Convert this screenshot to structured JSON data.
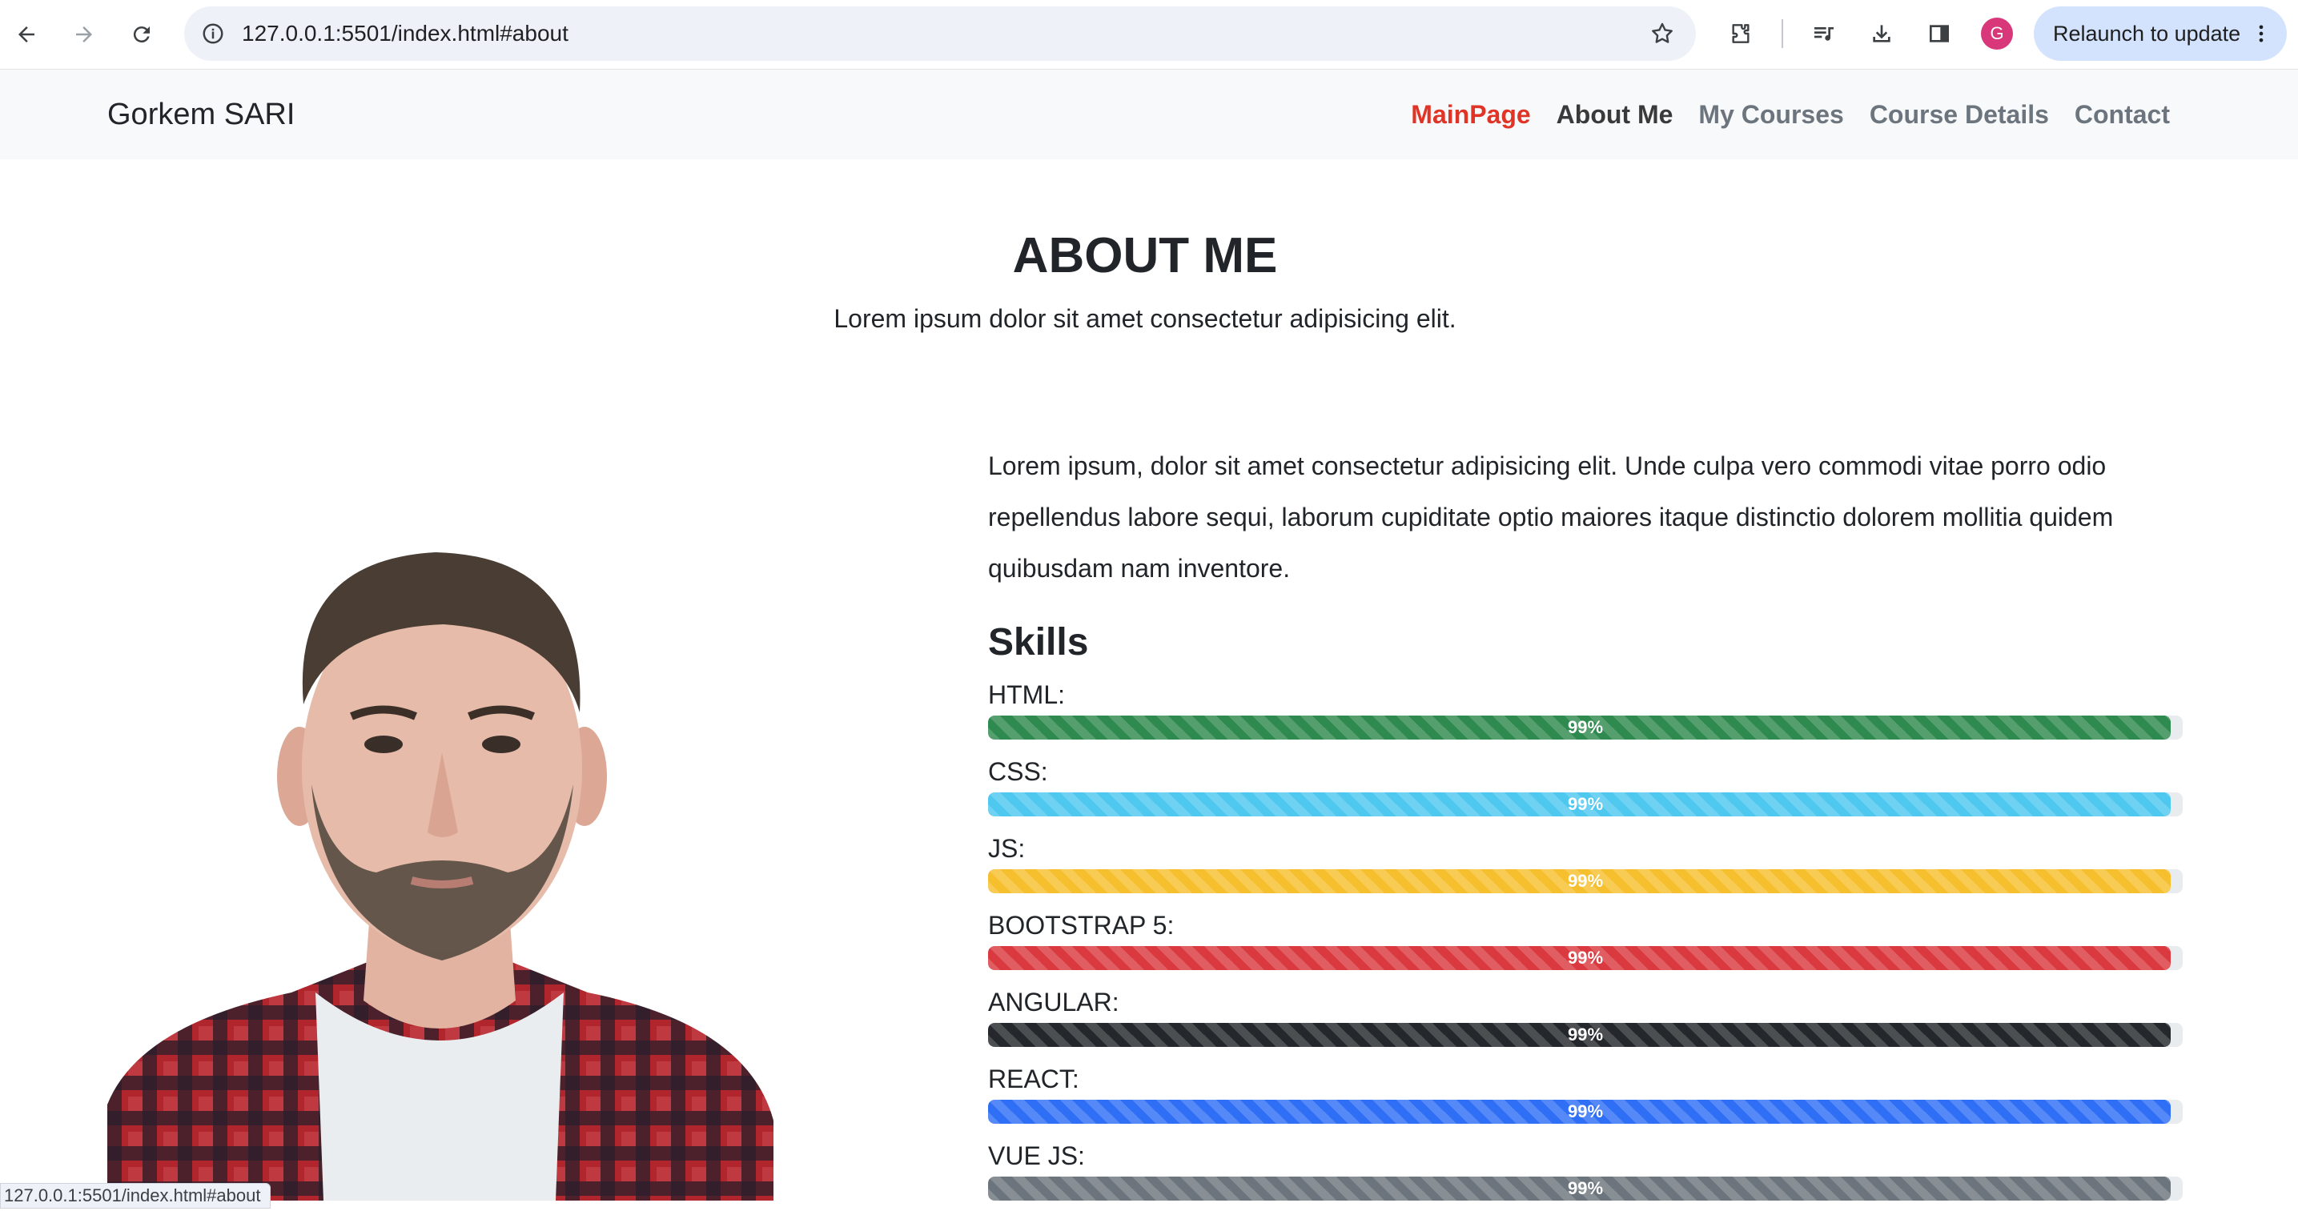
{
  "browser": {
    "url": "127.0.0.1:5501/index.html#about",
    "relaunch_label": "Relaunch to update",
    "profile_initial": "G",
    "status_url": "127.0.0.1:5501/index.html#about",
    "icons": [
      "back-arrow-icon",
      "forward-arrow-icon",
      "reload-icon",
      "site-info-icon",
      "bookmark-star-icon",
      "extensions-puzzle-icon",
      "media-queue-icon",
      "download-icon",
      "side-panel-icon",
      "more-vert-icon"
    ]
  },
  "navbar": {
    "brand": "Gorkem SARI",
    "links": [
      {
        "label": "MainPage"
      },
      {
        "label": "About Me"
      },
      {
        "label": "My Courses"
      },
      {
        "label": "Course Details"
      },
      {
        "label": "Contact"
      }
    ],
    "active_color": "#e03426"
  },
  "about": {
    "title": "ABOUT ME",
    "subtitle": "Lorem ipsum dolor sit amet consectetur adipisicing elit.",
    "paragraph": "Lorem ipsum, dolor sit amet consectetur adipisicing elit. Unde culpa vero commodi vitae porro odio repellendus labore sequi, laborum cupiditate optio maiores itaque distinctio dolorem mollitia quidem quibusdam nam inventore.",
    "skills_title": "Skills",
    "skills": [
      {
        "label": "HTML:",
        "percent_text": "99%",
        "value": 99,
        "color": "#2f8a4f"
      },
      {
        "label": "CSS:",
        "percent_text": "99%",
        "value": 99,
        "color": "#4fc8ef"
      },
      {
        "label": "JS:",
        "percent_text": "99%",
        "value": 99,
        "color": "#f6bf2e"
      },
      {
        "label": "BOOTSTRAP 5:",
        "percent_text": "99%",
        "value": 99,
        "color": "#d9393f"
      },
      {
        "label": "ANGULAR:",
        "percent_text": "99%",
        "value": 99,
        "color": "#24282c"
      },
      {
        "label": "REACT:",
        "percent_text": "99%",
        "value": 99,
        "color": "#2f6ff5"
      },
      {
        "label": "VUE JS:",
        "percent_text": "99%",
        "value": 99,
        "color": "#6c757d"
      }
    ]
  }
}
